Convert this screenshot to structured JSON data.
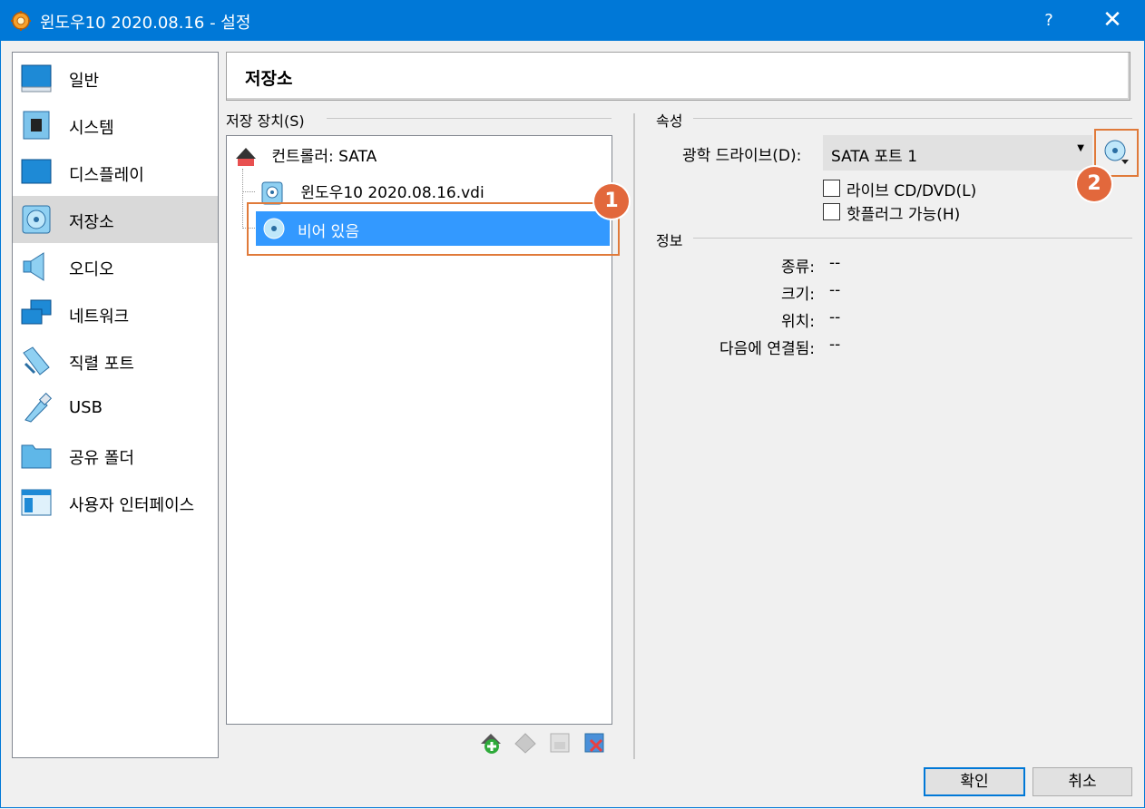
{
  "window": {
    "title": "윈도우10 2020.08.16 - 설정",
    "help_label": "?",
    "close_label": "✕"
  },
  "sidebar": {
    "items": [
      {
        "label": "일반",
        "icon": "general-icon"
      },
      {
        "label": "시스템",
        "icon": "system-chip-icon"
      },
      {
        "label": "디스플레이",
        "icon": "display-icon"
      },
      {
        "label": "저장소",
        "icon": "storage-disc-icon"
      },
      {
        "label": "오디오",
        "icon": "audio-speaker-icon"
      },
      {
        "label": "네트워크",
        "icon": "network-icon"
      },
      {
        "label": "직렬 포트",
        "icon": "serial-port-icon"
      },
      {
        "label": "USB",
        "icon": "usb-icon"
      },
      {
        "label": "공유 폴더",
        "icon": "shared-folder-icon"
      },
      {
        "label": "사용자 인터페이스",
        "icon": "user-interface-icon"
      }
    ],
    "selected": "저장소"
  },
  "header": {
    "title": "저장소"
  },
  "storage": {
    "group_label": "저장 장치(S)",
    "controller": "컨트롤러: SATA",
    "disk": "윈도우10 2020.08.16.vdi",
    "empty_drive": "비어 있음",
    "badge1": "1"
  },
  "attributes": {
    "group_label": "속성",
    "optical_label": "광학 드라이브(D):",
    "optical_value": "SATA 포트 1",
    "live_cd_label": "라이브 CD/DVD(L)",
    "hotplug_label": "핫플러그 가능(H)",
    "badge2": "2"
  },
  "info": {
    "group_label": "정보",
    "rows": [
      {
        "key": "종류:",
        "value": "--"
      },
      {
        "key": "크기:",
        "value": "--"
      },
      {
        "key": "위치:",
        "value": "--"
      },
      {
        "key": "다음에 연결됨:",
        "value": "--"
      }
    ]
  },
  "buttons": {
    "ok": "확인",
    "cancel": "취소"
  },
  "colors": {
    "titlebar": "#0078d7",
    "selection": "#3399ff",
    "highlight": "#e07a3a"
  }
}
